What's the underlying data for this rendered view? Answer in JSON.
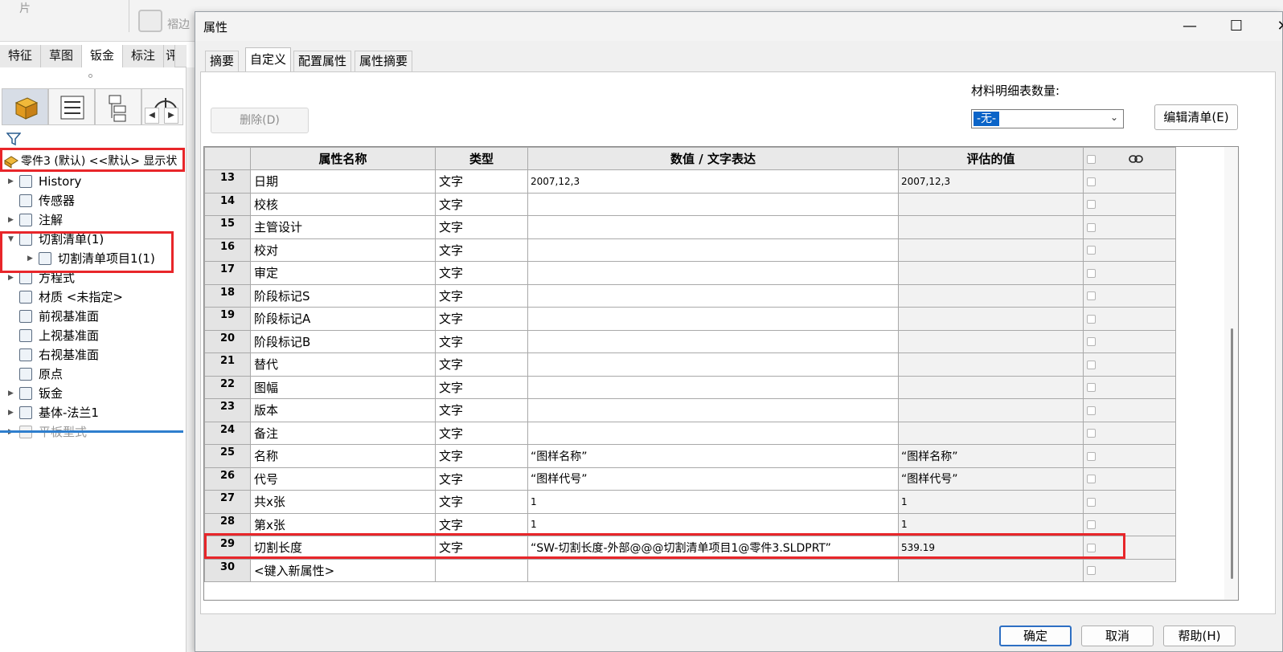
{
  "background_app": {
    "ribbon": {
      "item_1": "片",
      "item_2": "褶边"
    },
    "command_tabs": [
      "特征",
      "草图",
      "钣金",
      "标注",
      "评"
    ],
    "feature_tree": {
      "root": "零件3 (默认) <<默认> 显示状",
      "items": [
        {
          "label": "History",
          "expandable": true,
          "icon": "history-folder-icon"
        },
        {
          "label": "传感器",
          "expandable": false,
          "icon": "sensor-icon"
        },
        {
          "label": "注解",
          "expandable": true,
          "icon": "annotation-icon"
        },
        {
          "label": "切割清单(1)",
          "expandable": true,
          "expanded": true,
          "icon": "cut-list-icon"
        },
        {
          "label": "切割清单项目1(1)",
          "expandable": true,
          "icon": "cut-list-item-icon",
          "indent": 1
        },
        {
          "label": "方程式",
          "expandable": true,
          "icon": "equation-icon"
        },
        {
          "label": "材质 <未指定>",
          "expandable": false,
          "icon": "material-icon"
        },
        {
          "label": "前视基准面",
          "expandable": false,
          "icon": "plane-icon"
        },
        {
          "label": "上视基准面",
          "expandable": false,
          "icon": "plane-icon"
        },
        {
          "label": "右视基准面",
          "expandable": false,
          "icon": "plane-icon"
        },
        {
          "label": "原点",
          "expandable": false,
          "icon": "origin-icon"
        },
        {
          "label": "钣金",
          "expandable": true,
          "icon": "sheet-metal-icon"
        },
        {
          "label": "基体-法兰1",
          "expandable": true,
          "icon": "base-flange-icon"
        },
        {
          "label": "平板型式",
          "expandable": true,
          "icon": "flat-pattern-icon",
          "suppressed": true
        }
      ]
    }
  },
  "dialog": {
    "title": "属性",
    "window_controls": {
      "minimize": "—",
      "maximize": "☐",
      "close": "✕"
    },
    "tabs": [
      "摘要",
      "自定义",
      "配置属性",
      "属性摘要"
    ],
    "active_tab": "自定义",
    "delete_button": "删除(D)",
    "bom_quantity_label": "材料明细表数量:",
    "bom_quantity_value": "-无-",
    "edit_list_button": "编辑清单(E)",
    "columns": [
      "属性名称",
      "类型",
      "数值 / 文字表达",
      "评估的值"
    ],
    "rows": [
      {
        "num": "13",
        "name": "日期",
        "type": "文字",
        "value": "2007,12,3",
        "evaluated": "2007,12,3"
      },
      {
        "num": "14",
        "name": "校核",
        "type": "文字",
        "value": "",
        "evaluated": ""
      },
      {
        "num": "15",
        "name": "主管设计",
        "type": "文字",
        "value": "",
        "evaluated": ""
      },
      {
        "num": "16",
        "name": "校对",
        "type": "文字",
        "value": "",
        "evaluated": ""
      },
      {
        "num": "17",
        "name": "审定",
        "type": "文字",
        "value": "",
        "evaluated": ""
      },
      {
        "num": "18",
        "name": "阶段标记S",
        "type": "文字",
        "value": "",
        "evaluated": ""
      },
      {
        "num": "19",
        "name": "阶段标记A",
        "type": "文字",
        "value": "",
        "evaluated": ""
      },
      {
        "num": "20",
        "name": "阶段标记B",
        "type": "文字",
        "value": "",
        "evaluated": ""
      },
      {
        "num": "21",
        "name": "替代",
        "type": "文字",
        "value": "",
        "evaluated": ""
      },
      {
        "num": "22",
        "name": "图幅",
        "type": "文字",
        "value": "",
        "evaluated": ""
      },
      {
        "num": "23",
        "name": "版本",
        "type": "文字",
        "value": "",
        "evaluated": ""
      },
      {
        "num": "24",
        "name": "备注",
        "type": "文字",
        "value": "",
        "evaluated": ""
      },
      {
        "num": "25",
        "name": "名称",
        "type": "文字",
        "value": "“图样名称”",
        "evaluated": "“图样名称”"
      },
      {
        "num": "26",
        "name": "代号",
        "type": "文字",
        "value": "“图样代号”",
        "evaluated": "“图样代号”"
      },
      {
        "num": "27",
        "name": "共x张",
        "type": "文字",
        "value": "1",
        "evaluated": "1"
      },
      {
        "num": "28",
        "name": "第x张",
        "type": "文字",
        "value": "1",
        "evaluated": "1"
      },
      {
        "num": "29",
        "name": "切割长度",
        "type": "文字",
        "value": "“SW-切割长度-外部@@@切割清单项目1@零件3.SLDPRT”",
        "evaluated": "539.19"
      },
      {
        "num": "30",
        "name": "<键入新属性>",
        "type": "",
        "value": "",
        "evaluated": ""
      }
    ],
    "buttons": {
      "ok": "确定",
      "cancel": "取消",
      "help": "帮助(H)"
    }
  },
  "annotation_color": "#e8262a"
}
